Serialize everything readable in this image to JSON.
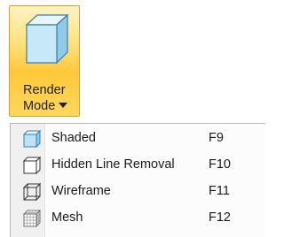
{
  "ribbon": {
    "render_mode": {
      "line1": "Render",
      "line2": "Mode",
      "icon": "shaded-cube-icon",
      "dropdown_icon": "dropdown-arrow-icon"
    }
  },
  "menu": {
    "items": [
      {
        "label": "Shaded",
        "shortcut": "F9",
        "icon": "shaded-cube-icon"
      },
      {
        "label": "Hidden Line Removal",
        "shortcut": "F10",
        "icon": "hidden-line-cube-icon"
      },
      {
        "label": "Wireframe",
        "shortcut": "F11",
        "icon": "wireframe-cube-icon"
      },
      {
        "label": "Mesh",
        "shortcut": "F12",
        "icon": "mesh-cube-icon"
      }
    ]
  },
  "colors": {
    "button_highlight": "#ffd85c",
    "button_border": "#c9a23a",
    "cube_face": "#bfe3f5",
    "cube_stroke": "#3b7fa8"
  }
}
